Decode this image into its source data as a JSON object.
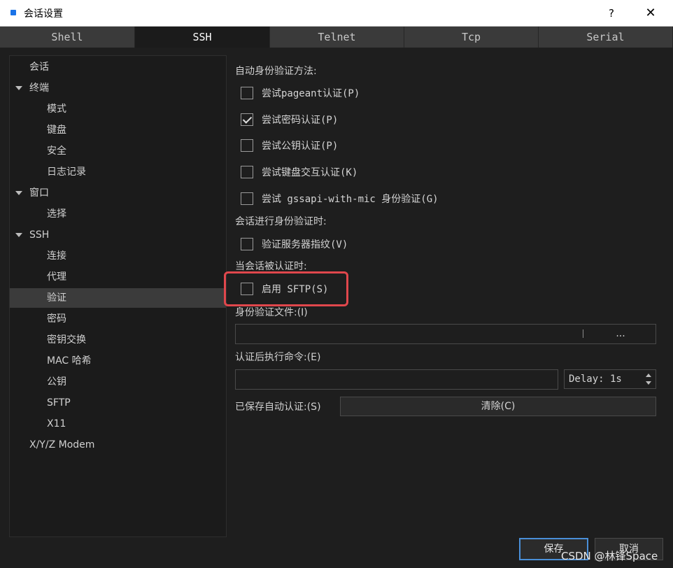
{
  "window": {
    "title": "会话设置",
    "help_label": "?",
    "close_label": "✕"
  },
  "tabs": [
    {
      "label": "Shell"
    },
    {
      "label": "SSH"
    },
    {
      "label": "Telnet"
    },
    {
      "label": "Tcp"
    },
    {
      "label": "Serial"
    }
  ],
  "active_tab": "SSH",
  "nav": {
    "items": [
      {
        "label": "会话"
      },
      {
        "label": "终端"
      },
      {
        "label": "模式"
      },
      {
        "label": "键盘"
      },
      {
        "label": "安全"
      },
      {
        "label": "日志记录"
      },
      {
        "label": "窗口"
      },
      {
        "label": "选择"
      },
      {
        "label": "SSH"
      },
      {
        "label": "连接"
      },
      {
        "label": "代理"
      },
      {
        "label": "验证"
      },
      {
        "label": "密码"
      },
      {
        "label": "密钥交换"
      },
      {
        "label": "MAC 哈希"
      },
      {
        "label": "公钥"
      },
      {
        "label": "SFTP"
      },
      {
        "label": "X11"
      },
      {
        "label": "X/Y/Z Modem"
      }
    ],
    "selected": "验证"
  },
  "auth": {
    "section_label": "自动身份验证方法:",
    "pageant": {
      "label": "尝试pageant认证(P)",
      "checked": false
    },
    "password": {
      "label": "尝试密码认证(P)",
      "checked": true
    },
    "publickey": {
      "label": "尝试公钥认证(P)",
      "checked": false
    },
    "keyboard": {
      "label": "尝试键盘交互认证(K)",
      "checked": false
    },
    "gssapi": {
      "label": "尝试 gssapi-with-mic 身份验证(G)",
      "checked": false
    }
  },
  "during_auth": {
    "section_label": "会话进行身份验证时:",
    "verify_fingerprint": {
      "label": "验证服务器指纹(V)",
      "checked": false
    }
  },
  "after_auth": {
    "section_label": "当会话被认证时:",
    "enable_sftp": {
      "label": "启用 SFTP(S)",
      "checked": false
    }
  },
  "identity_file": {
    "label": "身份验证文件:(I)",
    "value": "",
    "browse_label": "..."
  },
  "post_command": {
    "label": "认证后执行命令:(E)",
    "value": "",
    "delay_label": "Delay: 1s"
  },
  "saved_auth": {
    "label": "已保存自动认证:(S)",
    "clear_label": "清除(C)"
  },
  "buttons": {
    "save": "保存",
    "cancel": "取消"
  },
  "watermark": "CSDN @林锋Space",
  "colors": {
    "highlight": "#e0474c",
    "default_button_border": "#4a8fd8"
  }
}
